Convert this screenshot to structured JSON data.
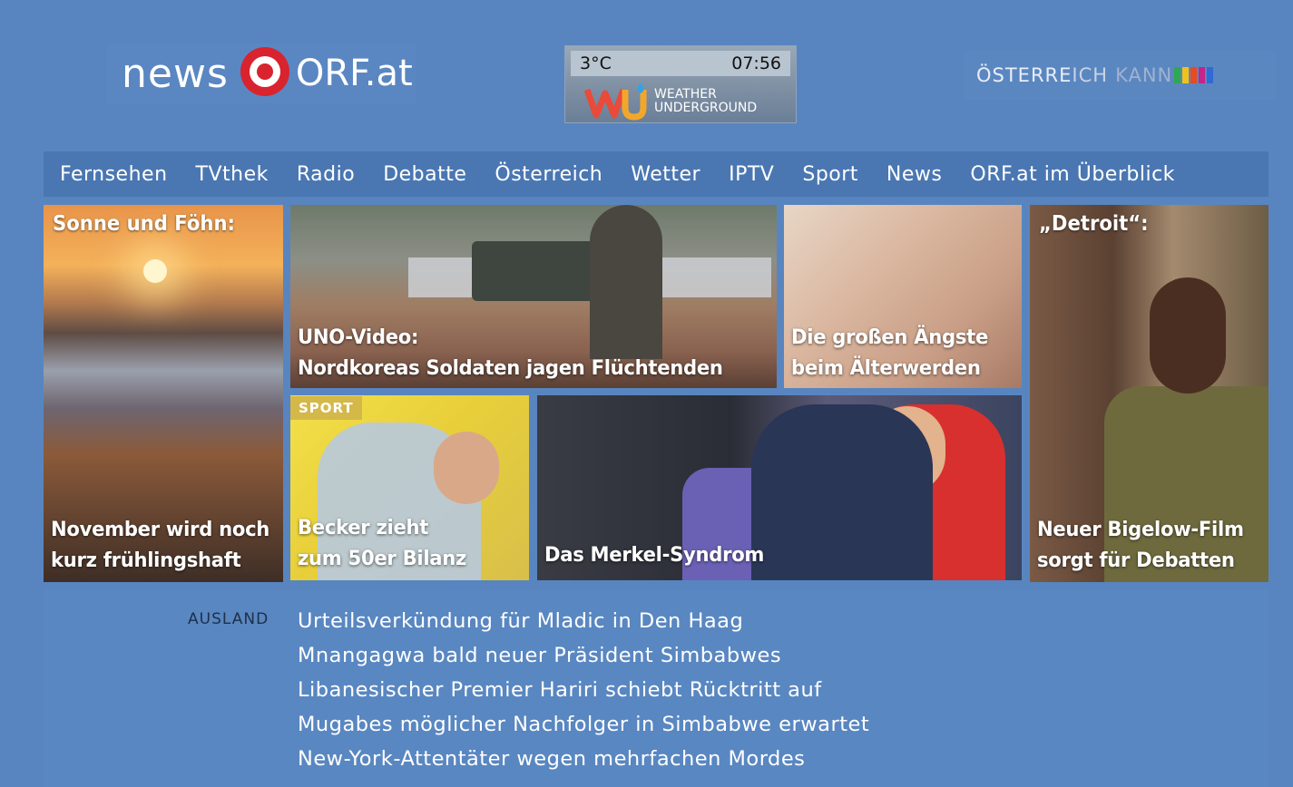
{
  "header": {
    "logo_news": "news",
    "logo_orf": "ORF.at",
    "weather": {
      "temperature": "3°C",
      "time": "07:56",
      "provider_line1": "WEATHER",
      "provider_line2": "UNDERGROUND"
    },
    "campaign": {
      "word1": "ÖSTERRE",
      "word2": "ICH",
      "word3": "KANN",
      "stripe_colors": [
        "#2fa84f",
        "#f2c21b",
        "#e94a1f",
        "#c4248c",
        "#2d6bd5"
      ]
    }
  },
  "nav": {
    "items": [
      {
        "label": "Fernsehen"
      },
      {
        "label": "TVthek"
      },
      {
        "label": "Radio"
      },
      {
        "label": "Debatte"
      },
      {
        "label": "Österreich"
      },
      {
        "label": "Wetter"
      },
      {
        "label": "IPTV"
      },
      {
        "label": "Sport"
      },
      {
        "label": "News"
      },
      {
        "label": "ORF.at im Überblick"
      }
    ]
  },
  "tiles": {
    "t1": {
      "top_caption": "Sonne und Föhn:",
      "line1": "November wird noch",
      "line2": "kurz frühlingshaft"
    },
    "t2": {
      "line1": "UNO-Video:",
      "line2": "Nordkoreas Soldaten jagen Flüchtenden"
    },
    "t3": {
      "line1": "Die großen Ängste",
      "line2": "beim Älterwerden"
    },
    "t4": {
      "top_caption": "„Detroit“:",
      "line1": "Neuer Bigelow-Film",
      "line2": "sorgt für Debatten"
    },
    "t5": {
      "tag": "SPORT",
      "line1": "Becker zieht",
      "line2": "zum 50er Bilanz"
    },
    "t6": {
      "line1": "Das Merkel-Syndrom"
    }
  },
  "news": {
    "section": "AUSLAND",
    "items": [
      "Urteilsverkündung für Mladic in Den Haag",
      "Mnangagwa bald neuer Präsident Simbabwes",
      "Libanesischer Premier Hariri schiebt Rücktritt auf",
      "Mugabes möglicher Nachfolger in Simbabwe erwartet",
      "New-York-Attentäter wegen mehrfachen Mordes"
    ]
  },
  "colors": {
    "background": "#5885c0",
    "nav_bar": "#4a77b2",
    "orf_red": "#d9232e",
    "sport_tag": "#d4b84a",
    "section_label": "#1d2f4b"
  }
}
